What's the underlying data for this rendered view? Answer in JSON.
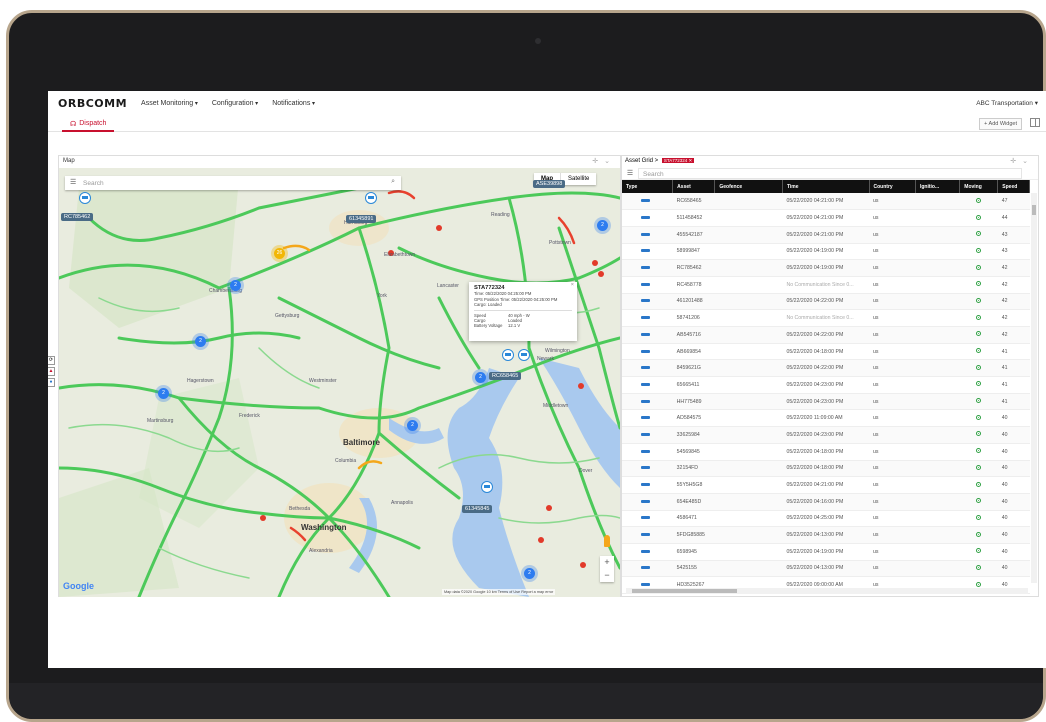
{
  "header": {
    "logo": "ORBCOMM",
    "nav": [
      "Asset Monitoring",
      "Configuration",
      "Notifications"
    ],
    "company": "ABC Transportation"
  },
  "tabs": {
    "dispatch": "Dispatch",
    "add_widget": "+ Add Widget"
  },
  "map_panel": {
    "title": "Map",
    "search_placeholder": "Search",
    "map_type": [
      "Map",
      "Satellite"
    ],
    "asset_labels": [
      "RC785462",
      "61345891",
      "RC658465",
      "61345845",
      "ASE39898"
    ],
    "clusters": [
      "2",
      "2",
      "2",
      "2",
      "2",
      "2",
      "2",
      "26"
    ],
    "cities": [
      "Baltimore",
      "Washington"
    ],
    "towns": [
      "Harrisburg",
      "Lancaster",
      "York",
      "Reading",
      "Hagerstown",
      "Frederick",
      "Gettysburg",
      "Wilmington",
      "Dover",
      "Columbia",
      "Annapolis",
      "Bethesda",
      "Alexandria",
      "Chambersburg",
      "Martinsburg",
      "Westminster",
      "Elizabethtown",
      "Pottstown",
      "Newark",
      "Middletown"
    ],
    "info_window": {
      "title": "STA772324",
      "time": "Time: 05/22/2020 04:25:00 PM",
      "gps_time": "GPS Position Time: 05/22/2020 04:25:00 PM",
      "cargo_top": "Cargo: Loaded",
      "speed": "Speed",
      "speed_val": "40 mph - W",
      "cargo": "Cargo",
      "cargo_val": "Loaded",
      "battery": "Battery Voltage",
      "battery_val": "12.1 V"
    },
    "google": "Google",
    "attribution": "Map data ©2020 Google   10 km   Terms of Use   Report a map error"
  },
  "grid_panel": {
    "breadcrumb": "Asset Grid >",
    "tag": "STA772324",
    "search_placeholder": "Search",
    "columns": [
      "Type",
      "Asset",
      "Geofence",
      "Time",
      "Country",
      "Ignitio...",
      "Moving",
      "Speed"
    ],
    "rows": [
      {
        "asset": "RC658465",
        "time": "05/22/2020 04:21:00 PM",
        "country": "us",
        "speed": "47"
      },
      {
        "asset": "511458452",
        "time": "05/22/2020 04:21:00 PM",
        "country": "us",
        "speed": "44"
      },
      {
        "asset": "455542187",
        "time": "05/22/2020 04:21:00 PM",
        "country": "us",
        "speed": "43"
      },
      {
        "asset": "58999847",
        "time": "05/22/2020 04:19:00 PM",
        "country": "us",
        "speed": "43"
      },
      {
        "asset": "RC785462",
        "time": "05/22/2020 04:19:00 PM",
        "country": "us",
        "speed": "42"
      },
      {
        "asset": "RC458778",
        "time": "No Communication Since 0...",
        "country": "us",
        "speed": "42"
      },
      {
        "asset": "461201488",
        "time": "05/22/2020 04:22:00 PM",
        "country": "us",
        "speed": "42"
      },
      {
        "asset": "58741206",
        "time": "No Communication Since 0...",
        "country": "us",
        "speed": "42"
      },
      {
        "asset": "AB545716",
        "time": "05/22/2020 04:22:00 PM",
        "country": "us",
        "speed": "42"
      },
      {
        "asset": "AB669854",
        "time": "05/22/2020 04:18:00 PM",
        "country": "us",
        "speed": "41"
      },
      {
        "asset": "8459621G",
        "time": "05/22/2020 04:22:00 PM",
        "country": "us",
        "speed": "41"
      },
      {
        "asset": "65665411",
        "time": "05/22/2020 04:23:00 PM",
        "country": "us",
        "speed": "41"
      },
      {
        "asset": "HH775489",
        "time": "05/22/2020 04:23:00 PM",
        "country": "us",
        "speed": "41"
      },
      {
        "asset": "AD584575",
        "time": "05/22/2020 11:09:00 AM",
        "country": "us",
        "speed": "40"
      },
      {
        "asset": "33625984",
        "time": "05/22/2020 04:23:00 PM",
        "country": "us",
        "speed": "40"
      },
      {
        "asset": "54569845",
        "time": "05/22/2020 04:18:00 PM",
        "country": "us",
        "speed": "40"
      },
      {
        "asset": "32154FD",
        "time": "05/22/2020 04:18:00 PM",
        "country": "us",
        "speed": "40"
      },
      {
        "asset": "55Y5H5G8",
        "time": "05/22/2020 04:21:00 PM",
        "country": "us",
        "speed": "40"
      },
      {
        "asset": "654E485D",
        "time": "05/22/2020 04:16:00 PM",
        "country": "us",
        "speed": "40"
      },
      {
        "asset": "4586471",
        "time": "05/22/2020 04:25:00 PM",
        "country": "us",
        "speed": "40"
      },
      {
        "asset": "5FDG85885",
        "time": "05/22/2020 04:13:00 PM",
        "country": "us",
        "speed": "40"
      },
      {
        "asset": "6598945",
        "time": "05/22/2020 04:19:00 PM",
        "country": "us",
        "speed": "40"
      },
      {
        "asset": "5425155",
        "time": "05/22/2020 04:13:00 PM",
        "country": "us",
        "speed": "40"
      },
      {
        "asset": "HD3525267",
        "time": "05/22/2020 09:00:00 AM",
        "country": "us",
        "speed": "40"
      }
    ]
  },
  "colors": {
    "accent": "#c8102e",
    "road": "#4cc95a",
    "water": "#a9c9ee",
    "cluster": "#2d7cf0",
    "table_header": "#111111"
  }
}
